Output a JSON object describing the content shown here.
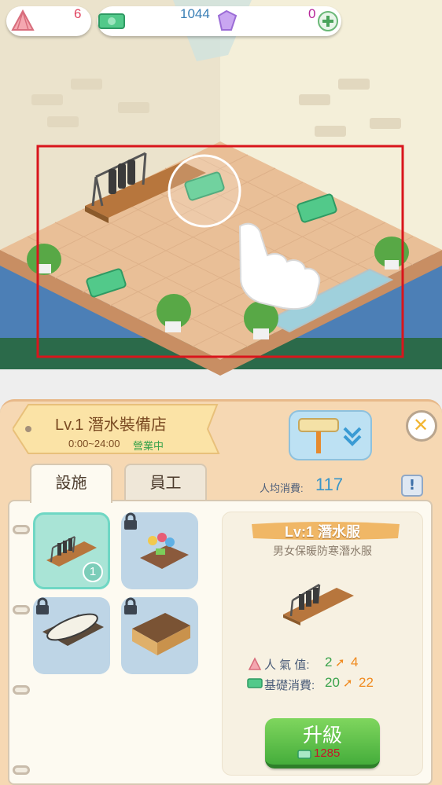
{
  "hud": {
    "shells": "6",
    "cash": "1044",
    "gems": "0"
  },
  "shop": {
    "title": "Lv.1 潛水裝備店",
    "hours": "0:00~24:00",
    "status": "營業中"
  },
  "tabs": {
    "facility": "設施",
    "staff": "員工"
  },
  "avg_spend": {
    "label": "人均消費:",
    "value": "117"
  },
  "facilities": {
    "selected_count": "1"
  },
  "detail": {
    "name": "Lv:1 潛水服",
    "description": "男女保暖防寒潛水服",
    "popularity_label": "人 氣 值:",
    "popularity_from": "2",
    "popularity_to": "4",
    "base_spend_label": "基礎消費:",
    "base_spend_from": "20",
    "base_spend_to": "22"
  },
  "upgrade": {
    "label": "升級",
    "cost": "1285"
  },
  "colors": {
    "accent_green": "#45ad3b",
    "cost_red": "#c4162a",
    "highlight_red": "#d9151c",
    "avg_blue": "#3a96c8"
  }
}
